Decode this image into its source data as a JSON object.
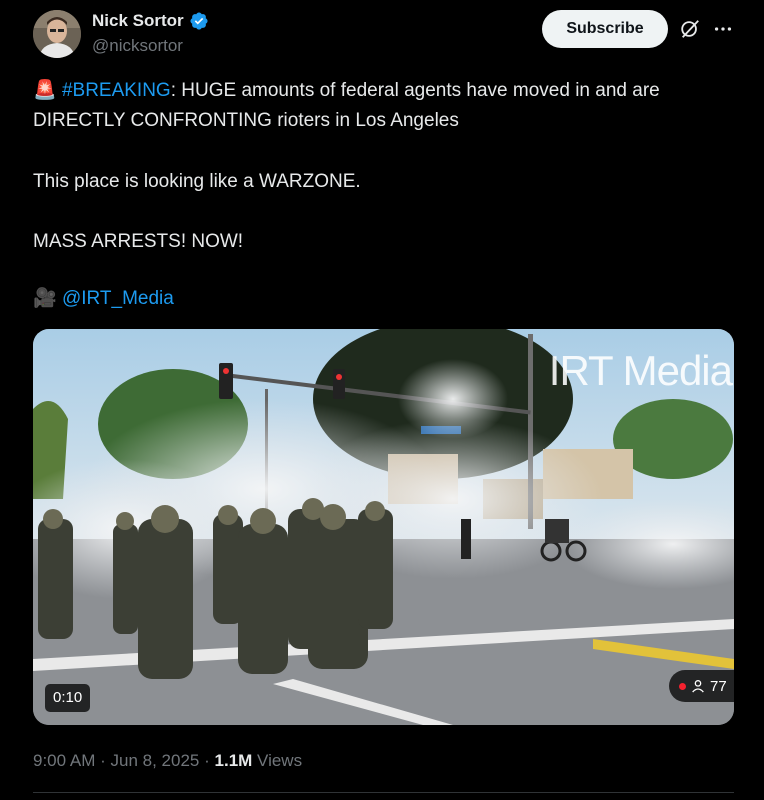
{
  "author": {
    "name": "Nick Sortor",
    "handle": "@nicksortor",
    "verified_color": "#1d9bf0"
  },
  "header": {
    "subscribe_label": "Subscribe",
    "grok_icon": "grok-icon",
    "more_icon": "more-icon"
  },
  "post": {
    "line1_emoji": "🚨",
    "line1_hashtag": "#BREAKING",
    "line1_rest": ": HUGE amounts of federal agents have moved in and are",
    "line2": "DIRECTLY CONFRONTING rioters in Los Angeles",
    "line3": "This place is looking like a WARZONE.",
    "line4": "MASS ARRESTS! NOW!",
    "credit_emoji": "🎥",
    "credit_mention": "@IRT_Media"
  },
  "media": {
    "watermark": "IRT Media",
    "duration": "0:10",
    "viewers": "77"
  },
  "footer": {
    "time": "9:00 AM",
    "date": "Jun 8, 2025",
    "views_count": "1.1M",
    "views_label": "Views",
    "separator": "·"
  }
}
